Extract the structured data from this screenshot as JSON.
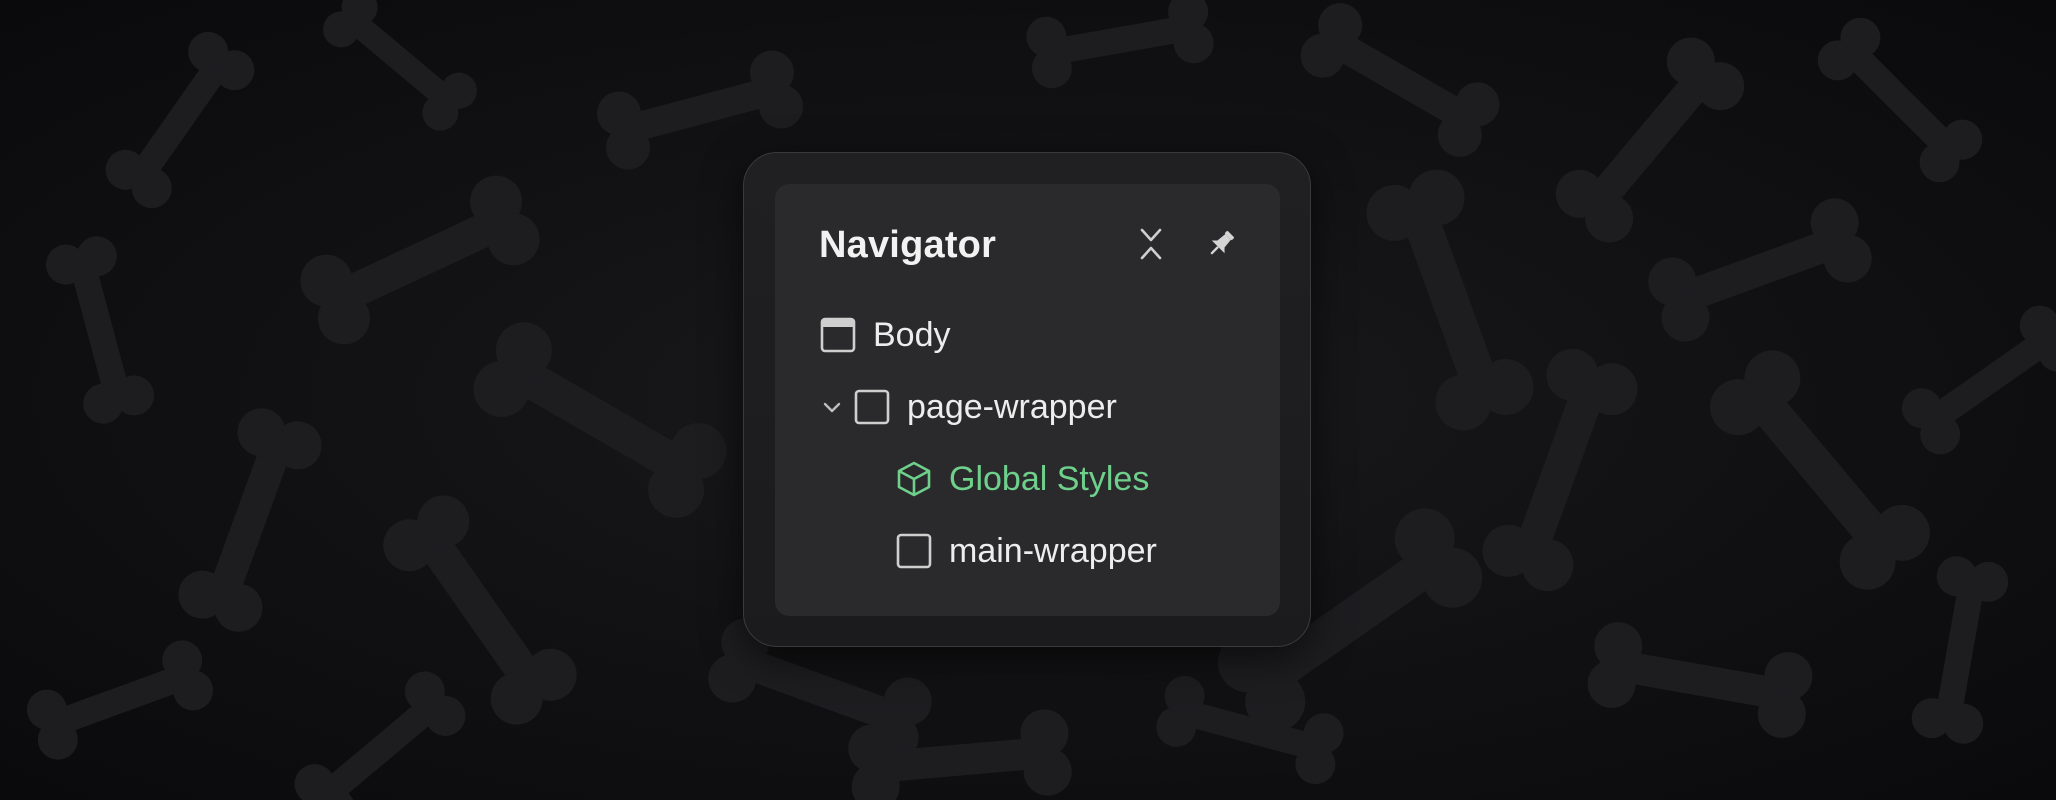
{
  "navigator": {
    "title": "Navigator",
    "collapse_icon": "collapse-arrows-icon",
    "pin_icon": "pin-icon",
    "tree": [
      {
        "label": "Body",
        "icon": "body-frame-icon",
        "expanded": null,
        "selected": false
      },
      {
        "label": "page-wrapper",
        "icon": "div-block-icon",
        "expanded": true,
        "selected": false
      },
      {
        "label": "Global Styles",
        "icon": "component-cube-icon",
        "expanded": null,
        "selected": false,
        "color": "#6fd08c"
      },
      {
        "label": "main-wrapper",
        "icon": "div-block-icon",
        "expanded": null,
        "selected": false
      }
    ]
  },
  "colors": {
    "background": "#0b0b0d",
    "panel": "#2a2a2c",
    "text": "#ededed",
    "component": "#6fd08c"
  }
}
